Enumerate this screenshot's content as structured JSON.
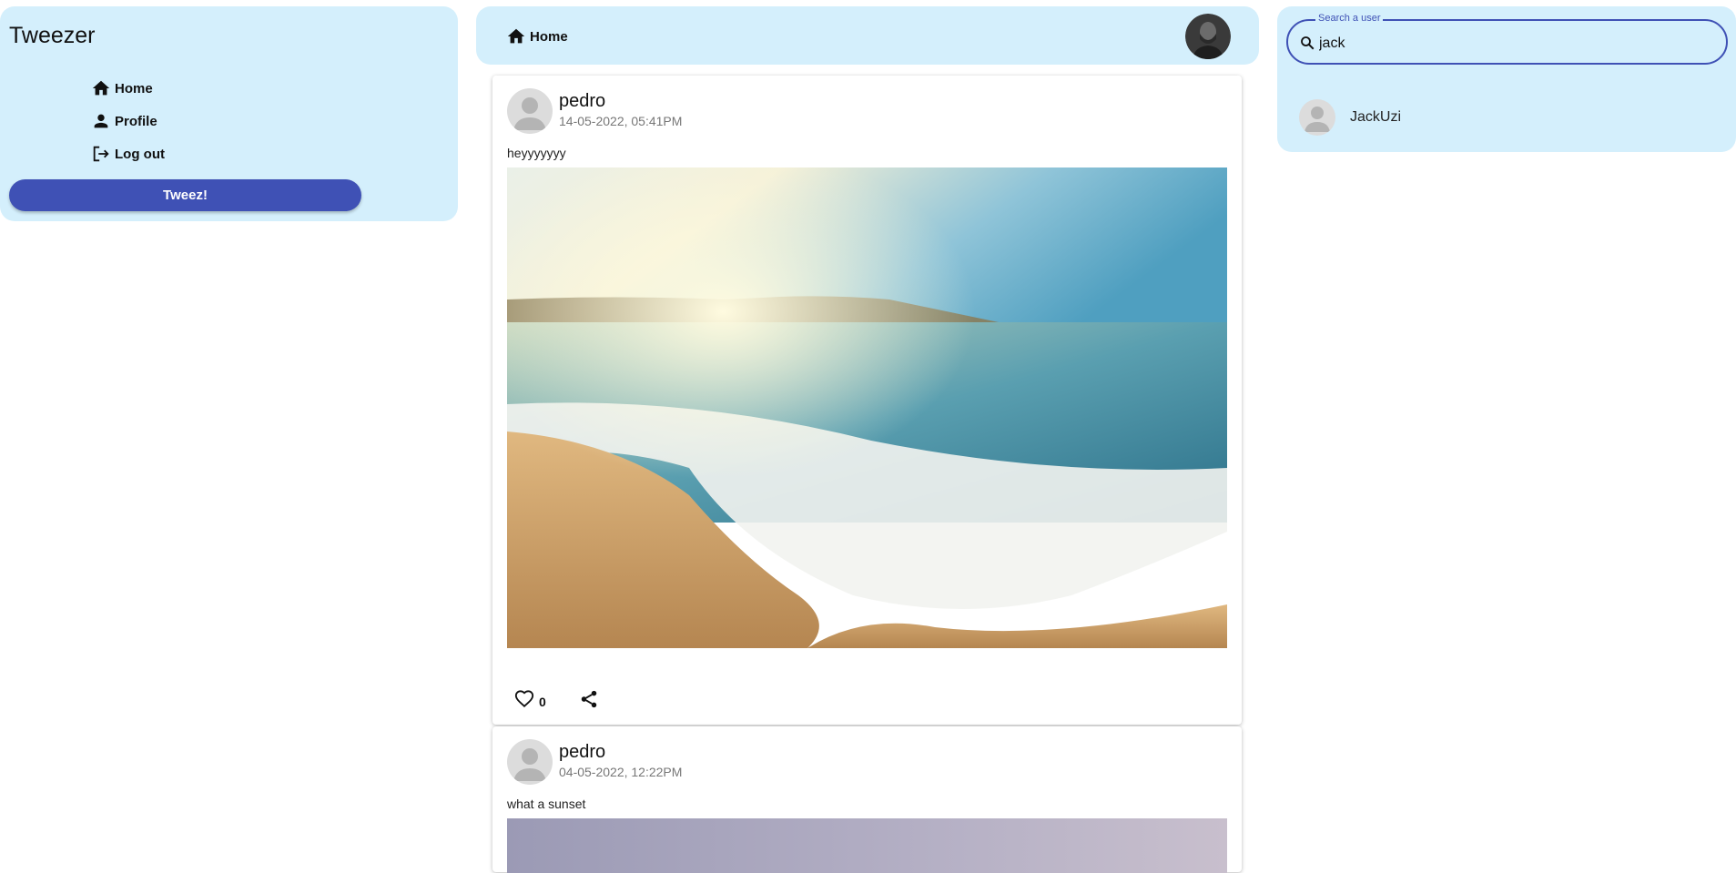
{
  "app": {
    "title": "Tweezer"
  },
  "nav": [
    {
      "label": "Home",
      "icon": "home-icon"
    },
    {
      "label": "Profile",
      "icon": "person-icon"
    },
    {
      "label": "Log out",
      "icon": "logout-icon"
    }
  ],
  "tweez_button": {
    "label": "Tweez!"
  },
  "topbar": {
    "breadcrumb": "Home",
    "breadcrumb_icon": "home-icon"
  },
  "search": {
    "label": "Search a user",
    "value": "jack",
    "icon": "search-icon"
  },
  "search_results": [
    {
      "name": "JackUzi"
    }
  ],
  "posts": [
    {
      "author": "pedro",
      "date": "14-05-2022, 05:41PM",
      "text": "heyyyyyyy",
      "image": "beach sunset",
      "likes": "0"
    },
    {
      "author": "pedro",
      "date": "04-05-2022, 12:22PM",
      "text": "what a sunset",
      "image": "sunset sky"
    }
  ],
  "colors": {
    "panel_bg": "#d4effc",
    "accent": "#3f51b5"
  }
}
